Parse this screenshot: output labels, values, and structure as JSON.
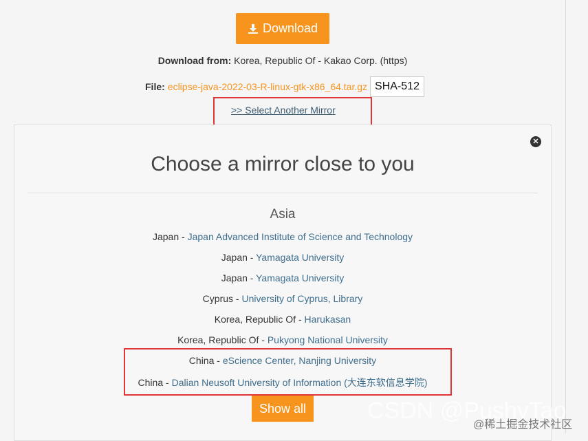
{
  "download": {
    "label": "Download",
    "icon": "download-icon"
  },
  "download_from": {
    "prefix": "Download from:",
    "value": "Korea, Republic Of - Kakao Corp. (https)"
  },
  "file": {
    "prefix": "File:",
    "name": "eclipse-java-2022-03-R-linux-gtk-x86_64.tar.gz",
    "hash": "SHA-512"
  },
  "select_mirror": ">> Select Another Mirror",
  "panel": {
    "title": "Choose a mirror close to you",
    "region": "Asia",
    "mirrors": [
      {
        "country": "Japan",
        "name": "Japan Advanced Institute of Science and Technology"
      },
      {
        "country": "Japan",
        "name": "Yamagata University"
      },
      {
        "country": "Japan",
        "name": "Yamagata University"
      },
      {
        "country": "Cyprus",
        "name": "University of Cyprus, Library"
      },
      {
        "country": "Korea, Republic Of",
        "name": "Harukasan"
      },
      {
        "country": "Korea, Republic Of",
        "name": "Pukyong National University"
      },
      {
        "country": "China",
        "name": "eScience Center, Nanjing University"
      },
      {
        "country": "China",
        "name": "Dalian Neusoft University of Information (大连东软信息学院)"
      }
    ],
    "separator": " - ",
    "show_all": "Show all"
  },
  "watermark": {
    "main": "CSDN @PushyTao",
    "sub": "@稀土掘金技术社区"
  },
  "colors": {
    "accent": "#f7941e",
    "link": "#3e6e8e",
    "highlight": "#e03535"
  }
}
